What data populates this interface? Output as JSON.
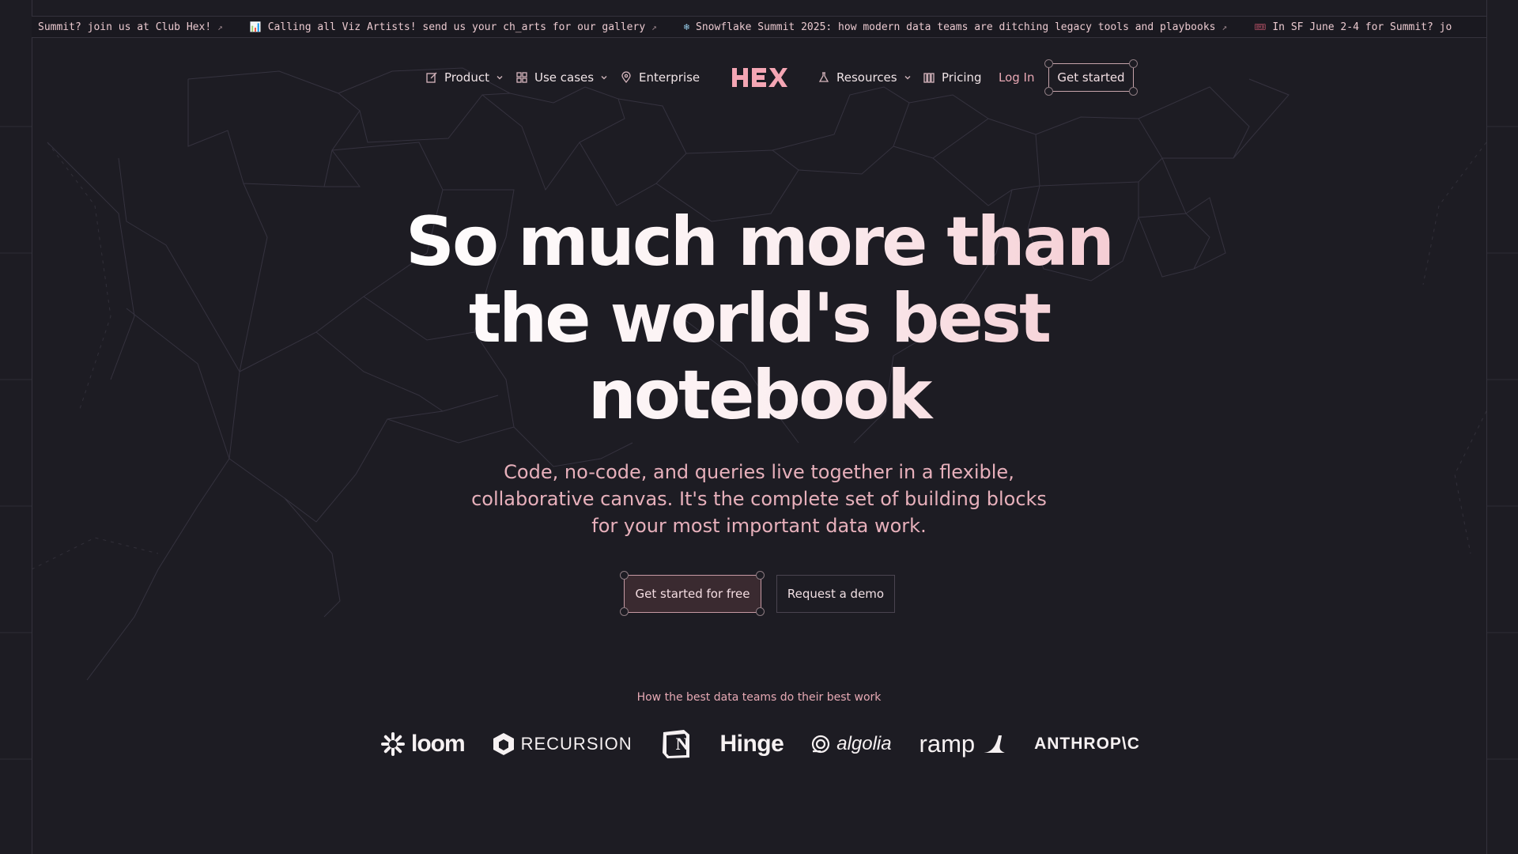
{
  "ticker": [
    {
      "icon": "",
      "text": "Summit? join us at Club Hex!",
      "arrow": "↗"
    },
    {
      "icon": "chart-icon",
      "glyph": "📊",
      "text": "Calling all Viz Artists! send us your ch_arts for our gallery",
      "arrow": "↗"
    },
    {
      "icon": "snowflake-icon",
      "glyph": "❄",
      "text": "Snowflake Summit 2025: how modern data teams are ditching legacy tools and playbooks",
      "arrow": "↗"
    },
    {
      "icon": "ticket-icon",
      "glyph": "🎟",
      "text": "In SF June 2-4 for Summit? jo",
      "arrow": ""
    }
  ],
  "nav": {
    "product": "Product",
    "use_cases": "Use cases",
    "enterprise": "Enterprise",
    "logo_text": "HEX",
    "resources": "Resources",
    "pricing": "Pricing",
    "login": "Log In",
    "get_started": "Get started"
  },
  "hero": {
    "line1": "So much more than",
    "line2": "the world's best",
    "line3": "notebook",
    "sub1": "Code, no-code, and queries live together in a flexible,",
    "sub2": "collaborative canvas. It's the complete set of building blocks",
    "sub3": "for your most important data work.",
    "cta_primary": "Get started for free",
    "cta_secondary": "Request a demo"
  },
  "customers": {
    "tagline": "How the best data teams do their best work",
    "logos": [
      "loom",
      "RECURSION",
      "N",
      "Hinge",
      "algolia",
      "ramp",
      "ANTHROP\\C"
    ]
  },
  "colors": {
    "background": "#1d1c23",
    "accent": "#f4c9d0",
    "subtext": "#e7b0bb"
  }
}
